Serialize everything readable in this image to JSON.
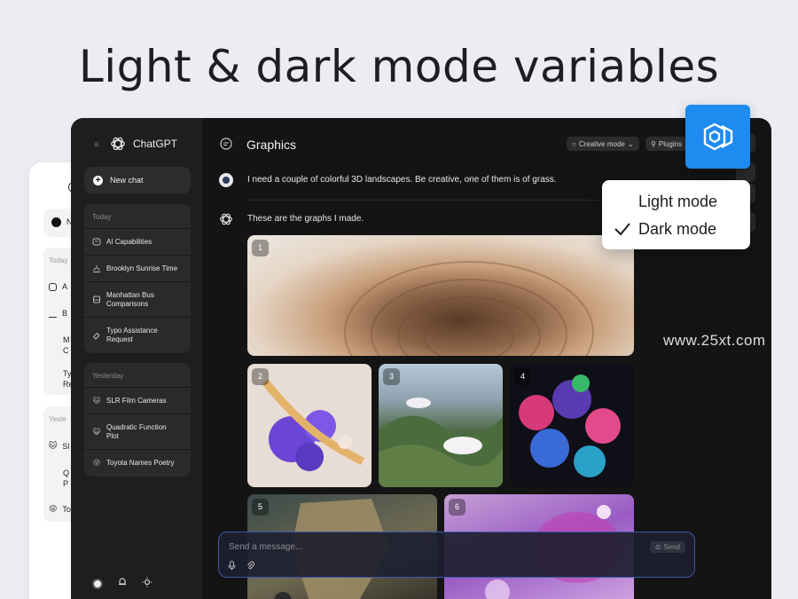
{
  "headline": "Light & dark mode variables",
  "watermark": "www.25xt.com",
  "app": {
    "brand": "ChatGPT",
    "title": "Graphics",
    "creative_mode": "Creative mode",
    "plugins": "Plugins",
    "user_message": "I need a couple of colorful 3D landscapes. Be creative, one of them is of grass.",
    "assistant_message": "These are the graphs I made.",
    "image_numbers": [
      "1",
      "2",
      "3",
      "4",
      "5",
      "6"
    ],
    "composer_placeholder": "Send a message...",
    "send_label": "Send"
  },
  "sidebar": {
    "new_chat": "New chat",
    "today_label": "Today",
    "today_items": [
      {
        "label": "AI Capabilities",
        "icon": "chat-icon"
      },
      {
        "label": "Brooklyn Sunrise Time",
        "icon": "sunrise-icon"
      },
      {
        "label": "Manhattan Bus Comparisons",
        "icon": "bus-icon"
      },
      {
        "label": "Typo Assistance Request",
        "icon": "eraser-icon"
      }
    ],
    "yesterday_label": "Yesterday",
    "yesterday_items": [
      {
        "label": "SLR Film Cameras",
        "icon": "emoji-camera-icon"
      },
      {
        "label": "Quadratic Function Plot",
        "icon": "emoji-cat-icon"
      },
      {
        "label": "Toyota Names Poetry",
        "icon": "emoji-face-icon"
      }
    ]
  },
  "light_window": {
    "new_initial": "N",
    "today_label": "Today",
    "today_items": [
      "A",
      "B",
      "M",
      "Ty"
    ],
    "today_items_line2": [
      "",
      "",
      "C",
      "Re"
    ],
    "yesterday_label": "Yeste",
    "yesterday_items": [
      "Sl",
      "Q",
      "To"
    ],
    "yesterday_items_line2": [
      "",
      "P",
      ""
    ]
  },
  "mode_menu": {
    "light": "Light mode",
    "dark": "Dark mode",
    "selected": "Dark mode"
  },
  "colors": {
    "accent": "#1e8bf1",
    "dark_bg": "#141414",
    "sidebar_bg": "#1e1e1e",
    "composer_border": "#3e58a6"
  }
}
